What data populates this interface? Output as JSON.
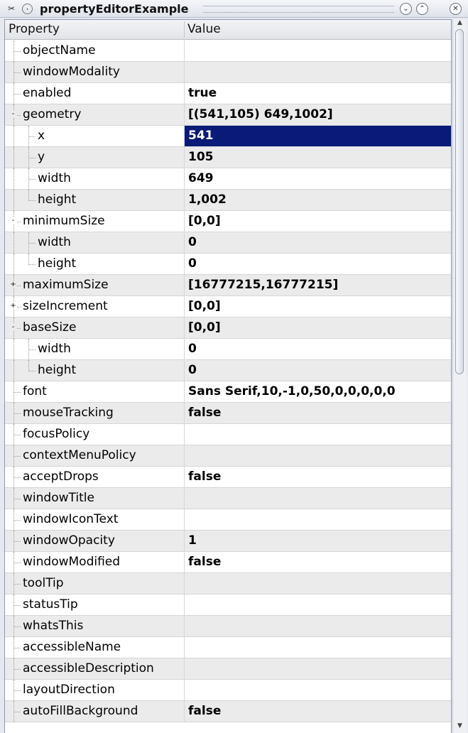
{
  "window": {
    "title": "propertyEditorExample",
    "icons": [
      "app-icon",
      "window-menu-icon",
      "minimize-icon",
      "maximize-icon",
      "close-icon"
    ],
    "minimize_glyph": "⌄",
    "maximize_glyph": "⌃",
    "close_glyph": "✕",
    "menu_glyph": "·",
    "app_glyph": "✂"
  },
  "table": {
    "headers": {
      "property": "Property",
      "value": "Value"
    },
    "selected_color": "#0a1a78",
    "rows": [
      {
        "label": "objectName",
        "value": "",
        "level": 0
      },
      {
        "label": "windowModality",
        "value": "",
        "level": 0
      },
      {
        "label": "enabled",
        "value": "true",
        "level": 0
      },
      {
        "label": "geometry",
        "value": "[(541,105) 649,1002]",
        "level": 0,
        "expander": "-"
      },
      {
        "label": "x",
        "value": "541",
        "level": 1,
        "selected": true
      },
      {
        "label": "y",
        "value": "105",
        "level": 1
      },
      {
        "label": "width",
        "value": "649",
        "level": 1
      },
      {
        "label": "height",
        "value": "1,002",
        "level": 1,
        "last": true
      },
      {
        "label": "minimumSize",
        "value": "[0,0]",
        "level": 0,
        "expander": "-"
      },
      {
        "label": "width",
        "value": "0",
        "level": 1
      },
      {
        "label": "height",
        "value": "0",
        "level": 1,
        "last": true
      },
      {
        "label": "maximumSize",
        "value": "[16777215,16777215]",
        "level": 0,
        "expander": "+"
      },
      {
        "label": "sizeIncrement",
        "value": "[0,0]",
        "level": 0,
        "expander": "+"
      },
      {
        "label": "baseSize",
        "value": "[0,0]",
        "level": 0,
        "expander": "-"
      },
      {
        "label": "width",
        "value": "0",
        "level": 1
      },
      {
        "label": "height",
        "value": "0",
        "level": 1,
        "last": true
      },
      {
        "label": "font",
        "value": "Sans Serif,10,-1,0,50,0,0,0,0,0",
        "level": 0
      },
      {
        "label": "mouseTracking",
        "value": "false",
        "level": 0
      },
      {
        "label": "focusPolicy",
        "value": "",
        "level": 0
      },
      {
        "label": "contextMenuPolicy",
        "value": "",
        "level": 0
      },
      {
        "label": "acceptDrops",
        "value": "false",
        "level": 0
      },
      {
        "label": "windowTitle",
        "value": "",
        "level": 0
      },
      {
        "label": "windowIconText",
        "value": "",
        "level": 0
      },
      {
        "label": "windowOpacity",
        "value": "1",
        "level": 0
      },
      {
        "label": "windowModified",
        "value": "false",
        "level": 0
      },
      {
        "label": "toolTip",
        "value": "",
        "level": 0
      },
      {
        "label": "statusTip",
        "value": "",
        "level": 0
      },
      {
        "label": "whatsThis",
        "value": "",
        "level": 0
      },
      {
        "label": "accessibleName",
        "value": "",
        "level": 0
      },
      {
        "label": "accessibleDescription",
        "value": "",
        "level": 0
      },
      {
        "label": "layoutDirection",
        "value": "",
        "level": 0
      },
      {
        "label": "autoFillBackground",
        "value": "false",
        "level": 0
      }
    ]
  },
  "scrollbar": {
    "up_glyph": "▲",
    "down_glyph": "▼"
  }
}
